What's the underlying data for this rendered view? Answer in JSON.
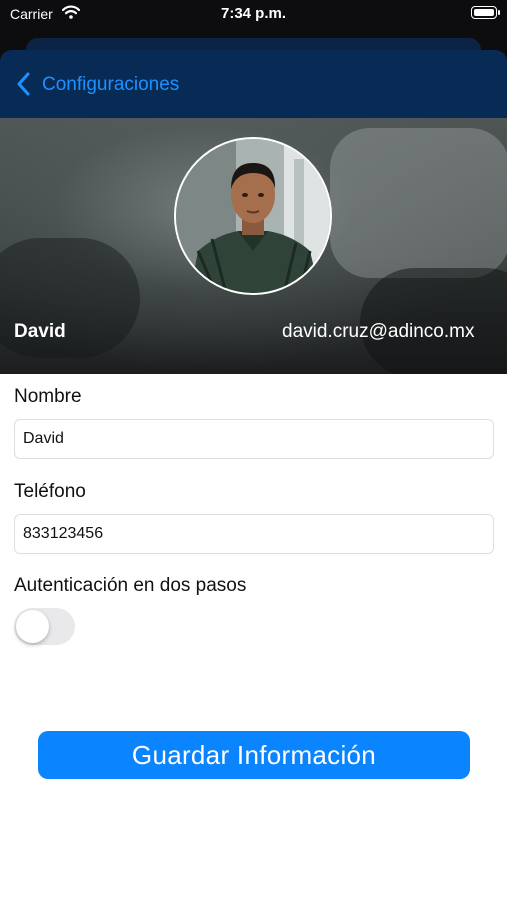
{
  "status_bar": {
    "carrier": "Carrier",
    "time": "7:34 p.m."
  },
  "nav": {
    "back_label": "Configuraciones"
  },
  "profile": {
    "name": "David",
    "email": "david.cruz@adinco.mx"
  },
  "form": {
    "name_label": "Nombre",
    "name_value": "David",
    "phone_label": "Teléfono",
    "phone_value": "833123456",
    "two_factor_label": "Autenticación en dos pasos",
    "two_factor_enabled": false,
    "save_label": "Guardar Información"
  },
  "colors": {
    "nav_background": "#082b55",
    "accent": "#0a84ff",
    "back_link": "#1e90ff"
  },
  "icons": {
    "status": [
      "wifi-icon",
      "battery-icon"
    ],
    "nav": "chevron-left-icon"
  }
}
